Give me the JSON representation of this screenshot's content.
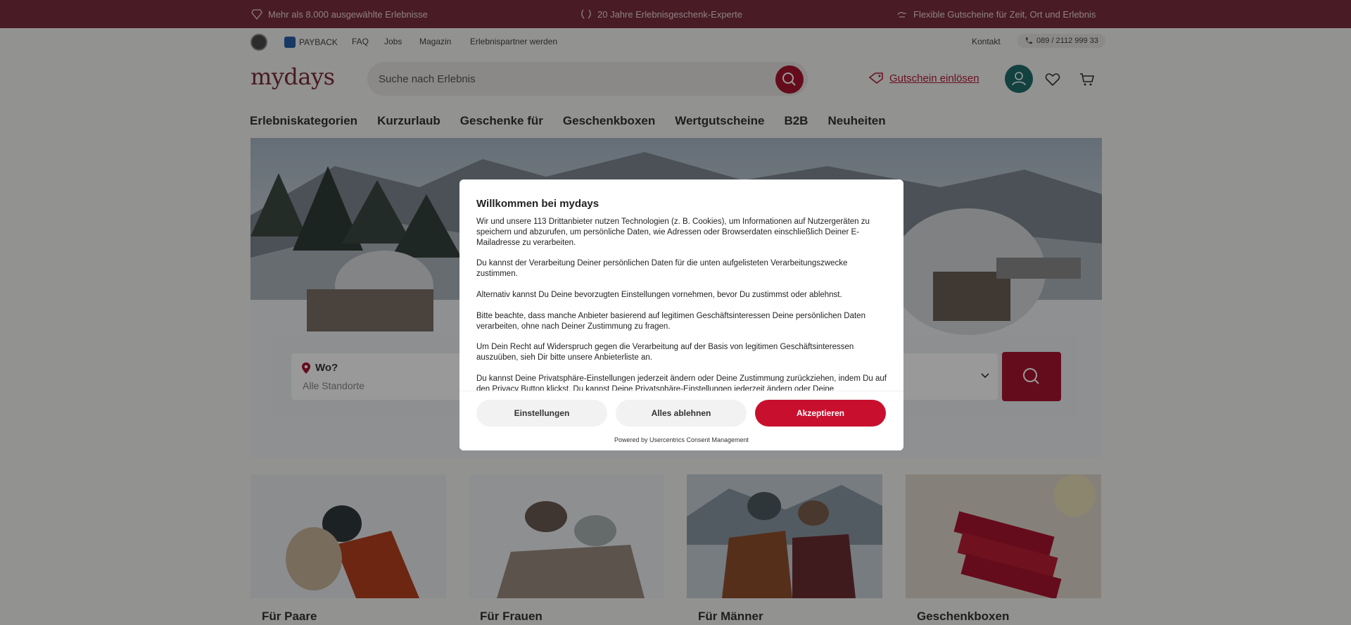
{
  "promo": {
    "items": [
      "Mehr als 8.000 ausgewählte Erlebnisse",
      "20 Jahre Erlebnisgeschenk-Experte",
      "Flexible Gutscheine für Zeit, Ort und Erlebnis"
    ]
  },
  "utility": {
    "payback": "PAYBACK",
    "faq": "FAQ",
    "jobs": "Jobs",
    "magazin": "Magazin",
    "partner": "Erlebnispartner werden",
    "kontakt": "Kontakt",
    "phone": "089 / 2112 999 33"
  },
  "header": {
    "logo": "mydays",
    "search_placeholder": "Suche nach Erlebnis",
    "voucher": "Gutschein einlösen"
  },
  "nav": [
    "Erlebniskategorien",
    "Kurzurlaub",
    "Geschenke für",
    "Geschenkboxen",
    "Wertgutscheine",
    "B2B",
    "Neuheiten"
  ],
  "hero": {
    "where_label": "Wo?",
    "where_value": "Alle Standorte"
  },
  "cards": [
    "Für Paare",
    "Für Frauen",
    "Für Männer",
    "Geschenkboxen"
  ],
  "consent": {
    "title": "Willkommen bei mydays",
    "paragraphs": [
      "Wir und unsere 113 Drittanbieter nutzen Technologien (z. B. Cookies), um Informationen auf Nutzergeräten zu speichern und abzurufen, um persönliche Daten, wie Adressen oder Browserdaten einschließlich Deiner E-Mailadresse zu verarbeiten.",
      "Du kannst der Verarbeitung Deiner persönlichen Daten für die unten aufgelisteten Verarbeitungszwecke zustimmen.",
      "Alternativ kannst Du Deine bevorzugten Einstellungen vornehmen, bevor Du zustimmst oder ablehnst.",
      "Bitte beachte, dass manche Anbieter basierend auf legitimen Geschäftsinteressen Deine persönlichen Daten verarbeiten, ohne nach Deiner Zustimmung zu fragen.",
      "Um Dein Recht auf Widerspruch gegen die Verarbeitung auf der Basis von legitimen Geschäftsinteressen auszuüben, sieh Dir bitte unsere Anbieterliste an.",
      "Du kannst Deine Privatsphäre-Einstellungen jederzeit ändern oder Deine Zustimmung zurückziehen, indem Du auf den Privacy Button klickst. Du kannst Deine Privatsphäre-Einstellungen jederzeit ändern oder Deine"
    ],
    "btn_settings": "Einstellungen",
    "btn_reject": "Alles ablehnen",
    "btn_accept": "Akzeptieren",
    "powered": "Powered by Usercentrics Consent Management"
  },
  "colors": {
    "brand": "#7a2d3d",
    "accent": "#a8152f",
    "accept": "#c8102e",
    "account": "#1f6d6b"
  }
}
